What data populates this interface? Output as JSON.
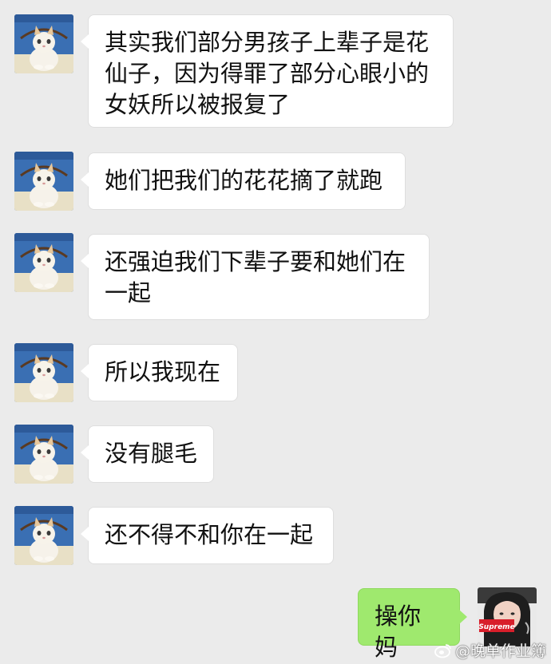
{
  "chat": {
    "messages": [
      {
        "side": "left",
        "avatar": "cat-avatar",
        "text": "其实我们部分男孩子上辈子是花仙子，因为得罪了部分心眼小的女妖所以被报复了"
      },
      {
        "side": "left",
        "avatar": "cat-avatar",
        "text": "她们把我们的花花摘了就跑"
      },
      {
        "side": "left",
        "avatar": "cat-avatar",
        "text": "还强迫我们下辈子要和她们在一起"
      },
      {
        "side": "left",
        "avatar": "cat-avatar",
        "text": "所以我现在"
      },
      {
        "side": "left",
        "avatar": "cat-avatar",
        "text": "没有腿毛"
      },
      {
        "side": "left",
        "avatar": "cat-avatar",
        "text": "还不得不和你在一起"
      },
      {
        "side": "right",
        "avatar": "girl-supreme-avatar",
        "text": "操你妈"
      }
    ],
    "self_avatar_sign": "Supreme"
  },
  "watermark": {
    "text": "@晚单作业簿"
  },
  "colors": {
    "background": "#ebebeb",
    "left_bubble": "#ffffff",
    "right_bubble": "#9fe96e",
    "supreme_red": "#d81e2a"
  }
}
